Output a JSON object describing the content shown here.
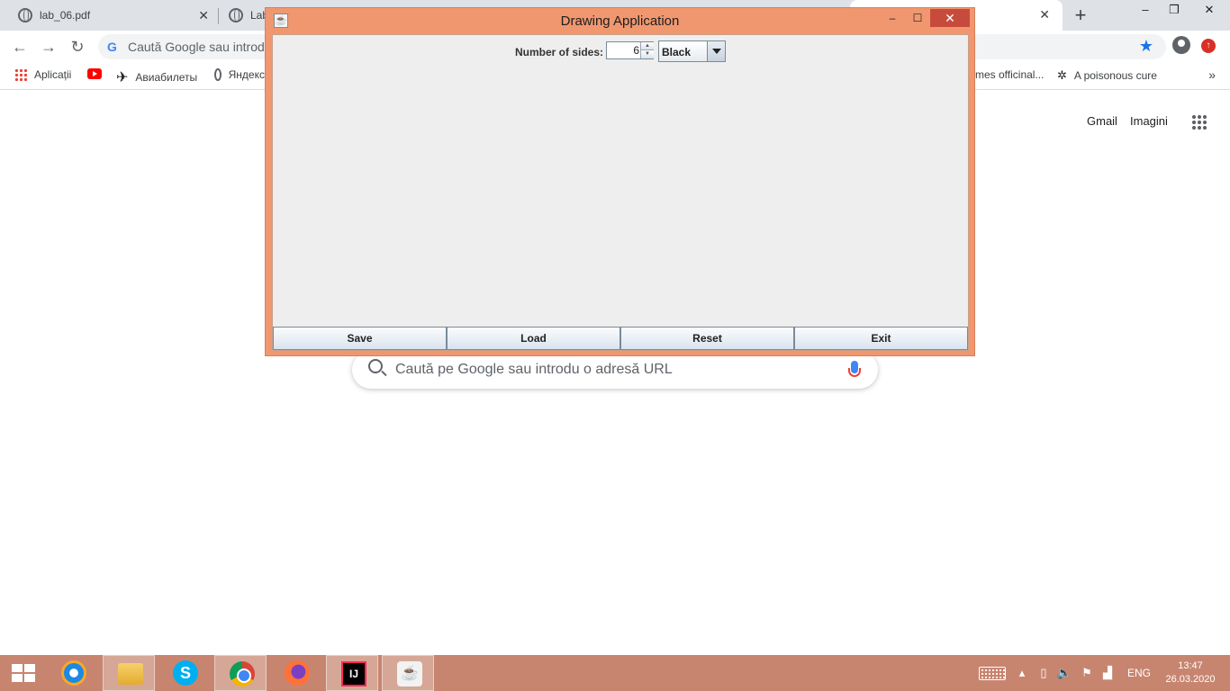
{
  "browser": {
    "tabs": [
      {
        "title": "lab_06.pdf"
      },
      {
        "title": "Lab"
      }
    ],
    "new_tab_symbol": "+",
    "omnibox_placeholder": "Caută Google sau introdu o adresă URL",
    "bookmarks": [
      {
        "label": "Aplicații"
      },
      {
        "label": ""
      },
      {
        "label": "Авиабилеты"
      },
      {
        "label": "Яндекс"
      },
      {
        "label": "mes officinal..."
      },
      {
        "label": "A poisonous cure"
      }
    ],
    "bookmarks_more": "»",
    "page_links": {
      "gmail": "Gmail",
      "images": "Imagini"
    },
    "search_placeholder": "Caută pe Google sau introdu o adresă URL"
  },
  "app": {
    "title": "Drawing Application",
    "controls": {
      "minimize": "‒",
      "maximize": "☐",
      "close": "✕"
    },
    "sides_label": "Number of sides:",
    "sides_value": "6",
    "color_value": "Black",
    "buttons": {
      "save": "Save",
      "load": "Load",
      "reset": "Reset",
      "exit": "Exit"
    }
  },
  "taskbar": {
    "language": "ENG",
    "time": "13:47",
    "date": "26.03.2020"
  },
  "colors": {
    "window_frame": "#f0976f",
    "close_button": "#c74b3d",
    "taskbar": "#c78570",
    "content_bg": "#eeeeee"
  },
  "icons": [
    "globe-icon",
    "apps-grid-icon",
    "youtube-icon",
    "plane-icon",
    "star-icon",
    "profile-icon",
    "java-icon",
    "windows-logo-icon",
    "ie-icon",
    "folder-icon",
    "skype-icon",
    "chrome-icon",
    "firefox-icon",
    "intellij-icon",
    "keyboard-icon",
    "speaker-icon",
    "network-icon",
    "flag-icon"
  ]
}
